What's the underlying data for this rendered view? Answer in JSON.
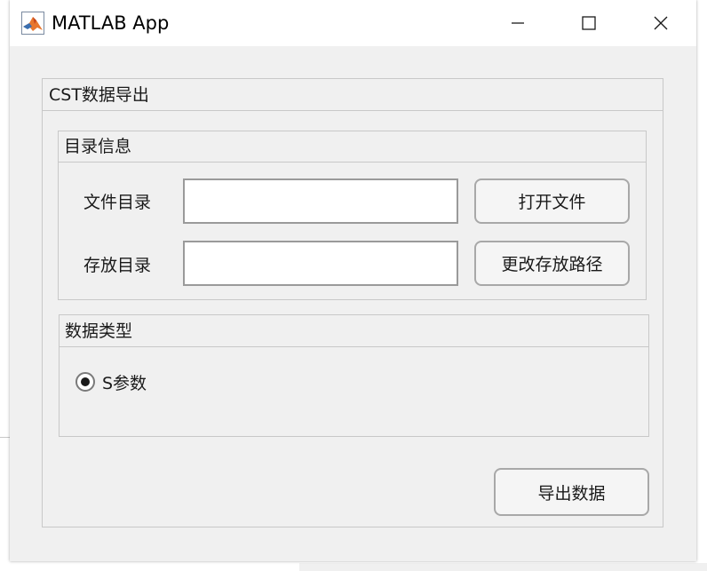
{
  "window": {
    "title": "MATLAB App",
    "icon": "matlab-logo-icon"
  },
  "main_panel": {
    "title": "CST数据导出"
  },
  "directory_panel": {
    "title": "目录信息",
    "file_dir_label": "文件目录",
    "file_dir_value": "",
    "open_file_button": "打开文件",
    "save_dir_label": "存放目录",
    "save_dir_value": "",
    "change_path_button": "更改存放路径"
  },
  "data_type_panel": {
    "title": "数据类型",
    "option_label": "S参数",
    "option_selected": true
  },
  "export_button": "导出数据"
}
